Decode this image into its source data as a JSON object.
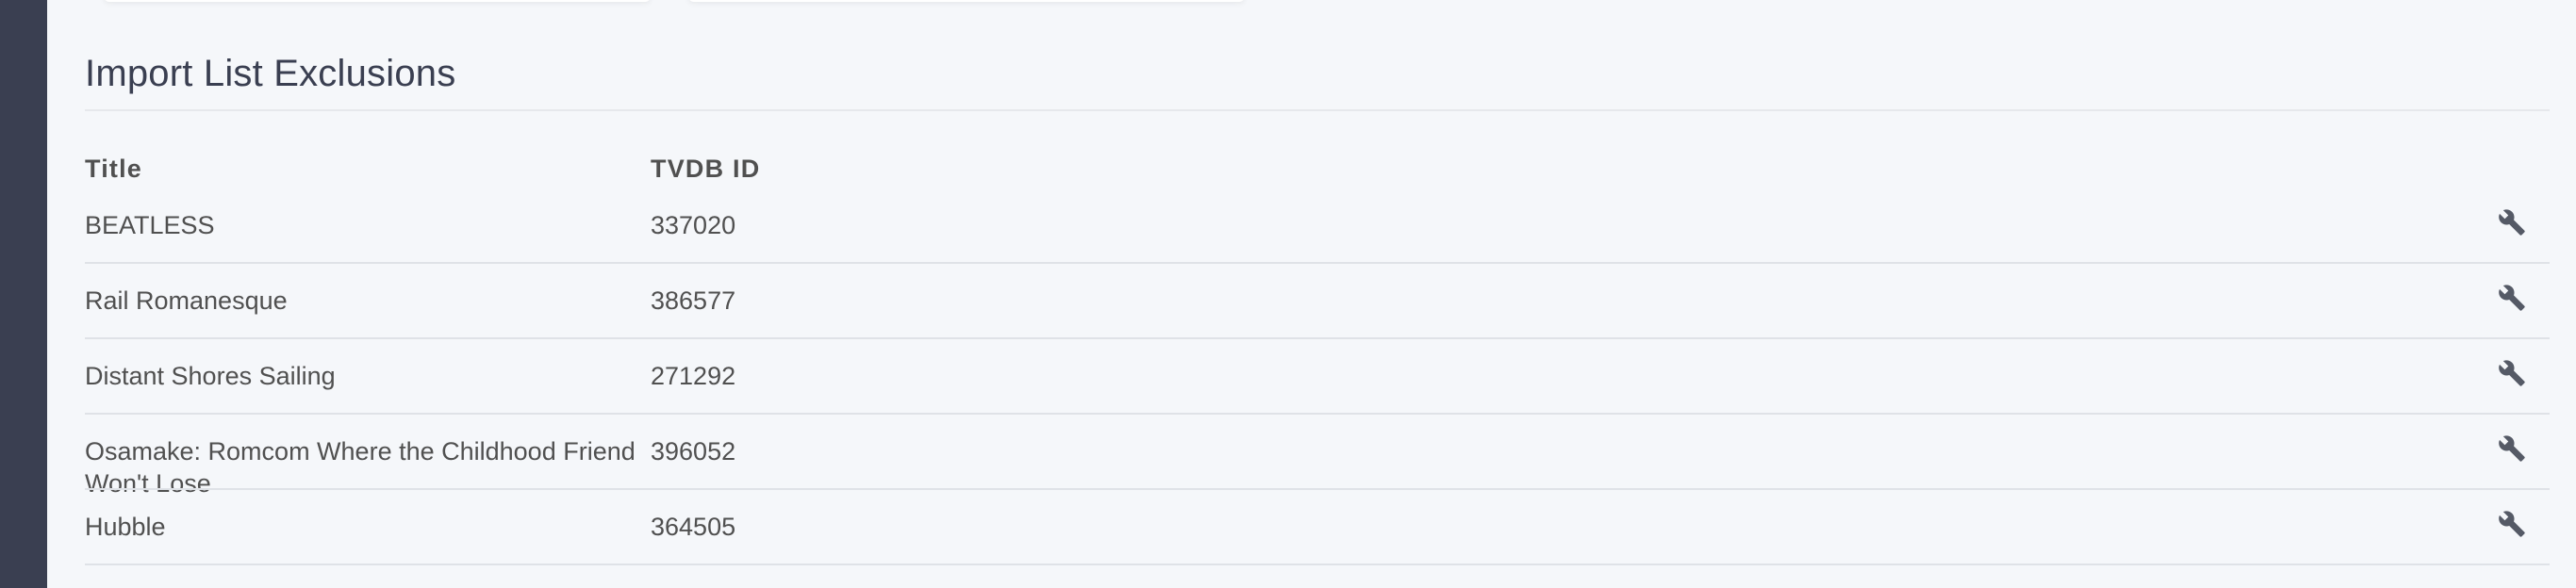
{
  "section": {
    "title": "Import List Exclusions"
  },
  "table": {
    "headers": {
      "title": "Title",
      "tvdb_id": "TVDB ID"
    },
    "rows": [
      {
        "title": "BEATLESS",
        "tvdb_id": "337020"
      },
      {
        "title": "Rail Romanesque",
        "tvdb_id": "386577"
      },
      {
        "title": "Distant Shores Sailing",
        "tvdb_id": "271292"
      },
      {
        "title": "Osamake: Romcom Where the Childhood Friend",
        "title_line2": "Won't Lose",
        "tvdb_id": "396052"
      },
      {
        "title": "Hubble",
        "tvdb_id": "364505"
      }
    ],
    "row_action_icon": "wrench-icon"
  },
  "colors": {
    "sidebar": "#3a3f51",
    "background": "#f5f7fa",
    "text": "#505050",
    "divider": "#dfe2e7"
  }
}
